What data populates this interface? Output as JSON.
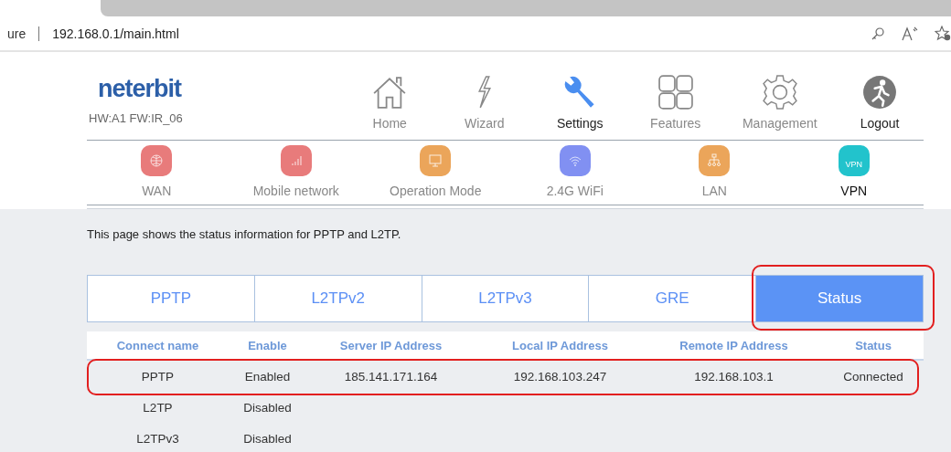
{
  "browser": {
    "security_text": "ure",
    "url": "192.168.0.1/main.html"
  },
  "header": {
    "logo": "neterbit",
    "version": "HW:A1 FW:IR_06"
  },
  "main_nav": [
    {
      "label": "Home",
      "kind": "home",
      "selected": false
    },
    {
      "label": "Wizard",
      "kind": "wizard",
      "selected": false
    },
    {
      "label": "Settings",
      "kind": "settings",
      "selected": true
    },
    {
      "label": "Features",
      "kind": "features",
      "selected": false
    },
    {
      "label": "Management",
      "kind": "management",
      "selected": false
    },
    {
      "label": "Logout",
      "kind": "logout",
      "selected": false
    }
  ],
  "sub_nav": [
    {
      "label": "WAN",
      "kind": "globe",
      "color": "#e87b7b",
      "selected": false
    },
    {
      "label": "Mobile network",
      "kind": "signal",
      "color": "#e87b7b",
      "selected": false
    },
    {
      "label": "Operation Mode",
      "kind": "monitor",
      "color": "#eba55a",
      "selected": false
    },
    {
      "label": "2.4G WiFi",
      "kind": "wifi",
      "color": "#8190f2",
      "selected": false
    },
    {
      "label": "LAN",
      "kind": "lan",
      "color": "#eba55a",
      "selected": false
    },
    {
      "label": "VPN",
      "kind": "vpn",
      "icon_text": "VPN",
      "color": "#22c3cc",
      "selected": true
    }
  ],
  "description": "This page shows the status information for PPTP and L2TP.",
  "tabs": [
    {
      "label": "PPTP",
      "selected": false
    },
    {
      "label": "L2TPv2",
      "selected": false
    },
    {
      "label": "L2TPv3",
      "selected": false
    },
    {
      "label": "GRE",
      "selected": false
    },
    {
      "label": "Status",
      "selected": true
    }
  ],
  "table": {
    "columns": [
      "Connect name",
      "Enable",
      "Server IP Address",
      "Local IP Address",
      "Remote IP Address",
      "Status"
    ],
    "rows": [
      [
        "PPTP",
        "Enabled",
        "185.141.171.164",
        "192.168.103.247",
        "192.168.103.1",
        "Connected"
      ],
      [
        "L2TP",
        "Disabled",
        "",
        "",
        "",
        ""
      ],
      [
        "L2TPv3",
        "Disabled",
        "",
        "",
        "",
        ""
      ]
    ]
  }
}
